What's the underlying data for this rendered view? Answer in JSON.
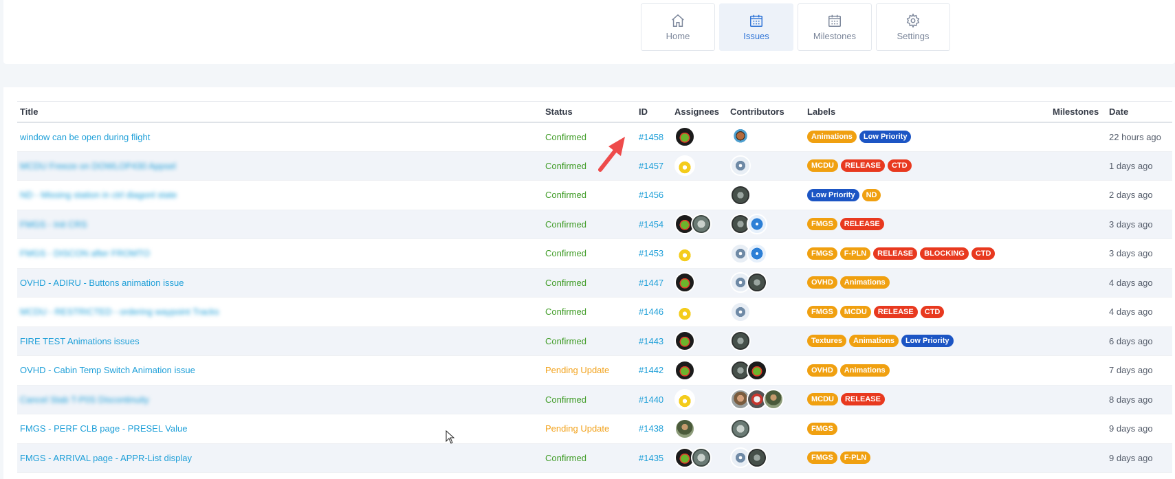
{
  "nav": {
    "tabs": [
      {
        "label": "Home",
        "icon": "home-icon"
      },
      {
        "label": "Issues",
        "icon": "calendar-icon",
        "active": true
      },
      {
        "label": "Milestones",
        "icon": "calendar-icon"
      },
      {
        "label": "Settings",
        "icon": "gear-icon"
      }
    ]
  },
  "table": {
    "headers": {
      "title": "Title",
      "status": "Status",
      "id": "ID",
      "assignees": "Assignees",
      "contributors": "Contributors",
      "labels": "Labels",
      "milestones": "Milestones",
      "date": "Date"
    },
    "rows": [
      {
        "title": "window can be open during flight",
        "blurred": false,
        "status": "Confirmed",
        "id": "#1458",
        "date": "22 hours ago"
      },
      {
        "title": "MCDU Freeze on DOWLOP430 Appsel",
        "blurred": true,
        "status": "Confirmed",
        "id": "#1457",
        "date": "1 days ago"
      },
      {
        "title": "ND - Missing station in ctrl diagonl state",
        "blurred": true,
        "status": "Confirmed",
        "id": "#1456",
        "date": "2 days ago"
      },
      {
        "title": "FMGS - Init CRS",
        "blurred": true,
        "status": "Confirmed",
        "id": "#1454",
        "date": "3 days ago"
      },
      {
        "title": "FMGS - DISCON after FROMTO",
        "blurred": true,
        "status": "Confirmed",
        "id": "#1453",
        "date": "3 days ago"
      },
      {
        "title": "OVHD - ADIRU - Buttons animation issue",
        "blurred": false,
        "status": "Confirmed",
        "id": "#1447",
        "date": "4 days ago"
      },
      {
        "title": "MCDU - RESTRICTED - ordering waypoint Tracks",
        "blurred": true,
        "status": "Confirmed",
        "id": "#1446",
        "date": "4 days ago"
      },
      {
        "title": "FIRE TEST Animations issues",
        "blurred": false,
        "status": "Confirmed",
        "id": "#1443",
        "date": "6 days ago"
      },
      {
        "title": "OVHD - Cabin Temp Switch Animation issue",
        "blurred": false,
        "status": "Pending Update",
        "id": "#1442",
        "date": "7 days ago"
      },
      {
        "title": "Cancel Stab T-P0S Discontinuity",
        "blurred": true,
        "status": "Confirmed",
        "id": "#1440",
        "date": "8 days ago"
      },
      {
        "title": "FMGS - PERF CLB page - PRESEL Value",
        "blurred": false,
        "status": "Pending Update",
        "id": "#1438",
        "date": "9 days ago"
      },
      {
        "title": "FMGS - ARRIVAL page - APPR-List display",
        "blurred": false,
        "status": "Confirmed",
        "id": "#1435",
        "date": "9 days ago"
      }
    ]
  },
  "row_labels": [
    [
      {
        "text": "Animations",
        "color": "orange"
      },
      {
        "text": "Low Priority",
        "color": "blue"
      }
    ],
    [
      {
        "text": "MCDU",
        "color": "orange"
      },
      {
        "text": "RELEASE",
        "color": "red"
      },
      {
        "text": "CTD",
        "color": "red"
      }
    ],
    [
      {
        "text": "Low Priority",
        "color": "blue"
      },
      {
        "text": "ND",
        "color": "orange"
      }
    ],
    [
      {
        "text": "FMGS",
        "color": "orange"
      },
      {
        "text": "RELEASE",
        "color": "red"
      }
    ],
    [
      {
        "text": "FMGS",
        "color": "orange"
      },
      {
        "text": "F-PLN",
        "color": "orange"
      },
      {
        "text": "RELEASE",
        "color": "red"
      },
      {
        "text": "BLOCKING",
        "color": "red"
      },
      {
        "text": "CTD",
        "color": "red"
      }
    ],
    [
      {
        "text": "OVHD",
        "color": "orange"
      },
      {
        "text": "Animations",
        "color": "orange"
      }
    ],
    [
      {
        "text": "FMGS",
        "color": "orange"
      },
      {
        "text": "MCDU",
        "color": "orange"
      },
      {
        "text": "RELEASE",
        "color": "red"
      },
      {
        "text": "CTD",
        "color": "red"
      }
    ],
    [
      {
        "text": "Textures",
        "color": "orange"
      },
      {
        "text": "Animations",
        "color": "orange"
      },
      {
        "text": "Low Priority",
        "color": "blue"
      }
    ],
    [
      {
        "text": "OVHD",
        "color": "orange"
      },
      {
        "text": "Animations",
        "color": "orange"
      }
    ],
    [
      {
        "text": "MCDU",
        "color": "orange"
      },
      {
        "text": "RELEASE",
        "color": "red"
      }
    ],
    [
      {
        "text": "FMGS",
        "color": "orange"
      }
    ],
    [
      {
        "text": "FMGS",
        "color": "orange"
      },
      {
        "text": "F-PLN",
        "color": "orange"
      }
    ]
  ],
  "row_avatars": [
    {
      "assignees": [
        "parrot"
      ],
      "contributors": [
        "face"
      ]
    },
    {
      "assignees": [
        "robot"
      ],
      "contributors": [
        "gear"
      ]
    },
    {
      "assignees": [],
      "contributors": [
        "screen"
      ]
    },
    {
      "assignees": [
        "parrot",
        "plane"
      ],
      "contributors": [
        "screen",
        "blue"
      ]
    },
    {
      "assignees": [
        "robot"
      ],
      "contributors": [
        "gear",
        "blue"
      ]
    },
    {
      "assignees": [
        "parrot"
      ],
      "contributors": [
        "gear",
        "screen"
      ]
    },
    {
      "assignees": [
        "robot"
      ],
      "contributors": [
        "gear"
      ]
    },
    {
      "assignees": [
        "parrot"
      ],
      "contributors": [
        "screen"
      ]
    },
    {
      "assignees": [
        "parrot"
      ],
      "contributors": [
        "screen",
        "parrot"
      ]
    },
    {
      "assignees": [
        "robot"
      ],
      "contributors": [
        "photo",
        "red",
        "man"
      ]
    },
    {
      "assignees": [
        "man"
      ],
      "contributors": [
        "plane"
      ]
    },
    {
      "assignees": [
        "parrot",
        "plane"
      ],
      "contributors": [
        "gear",
        "screen"
      ]
    }
  ],
  "colors": {
    "link": "#1e9fd8",
    "confirmed": "#3e9b25",
    "pending": "#f2a21b",
    "label_orange": "#f0a010",
    "label_red": "#e8391f",
    "label_blue": "#1c55c4",
    "active_tab": "#2d73d6"
  }
}
